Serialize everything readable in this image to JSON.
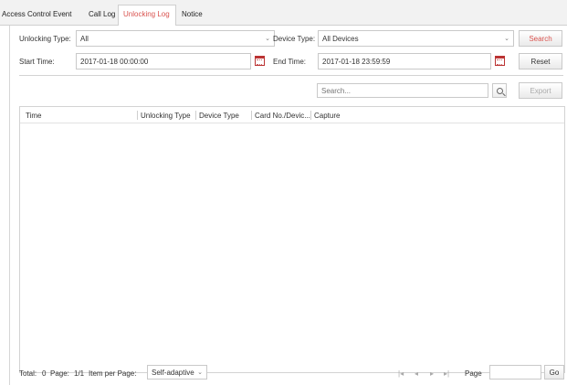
{
  "tabs": [
    {
      "label": "Access Control Event",
      "active": false
    },
    {
      "label": "Call Log",
      "active": false
    },
    {
      "label": "Unlocking Log",
      "active": true
    },
    {
      "label": "Notice",
      "active": false
    }
  ],
  "filters": {
    "unlocking_type_label": "Unlocking Type:",
    "unlocking_type_value": "All",
    "device_type_label": "Device Type:",
    "device_type_value": "All Devices",
    "start_time_label": "Start Time:",
    "start_time_value": "2017-01-18 00:00:00",
    "end_time_label": "End Time:",
    "end_time_value": "2017-01-18 23:59:59",
    "search_button": "Search",
    "reset_button": "Reset"
  },
  "toolbar": {
    "search_placeholder": "Search...",
    "export_button": "Export"
  },
  "table": {
    "columns": [
      "Time",
      "Unlocking Type",
      "Device Type",
      "Card No./Devic...",
      "Capture"
    ],
    "rows": []
  },
  "footer": {
    "total_label": "Total:",
    "total_value": "0",
    "page_label": "Page:",
    "page_value": "1/1",
    "item_per_page_label": "Item per Page:",
    "item_per_page_value": "Self-adaptive",
    "page_input_label": "Page",
    "go_button": "Go"
  },
  "colors": {
    "accent": "#d9534f"
  }
}
